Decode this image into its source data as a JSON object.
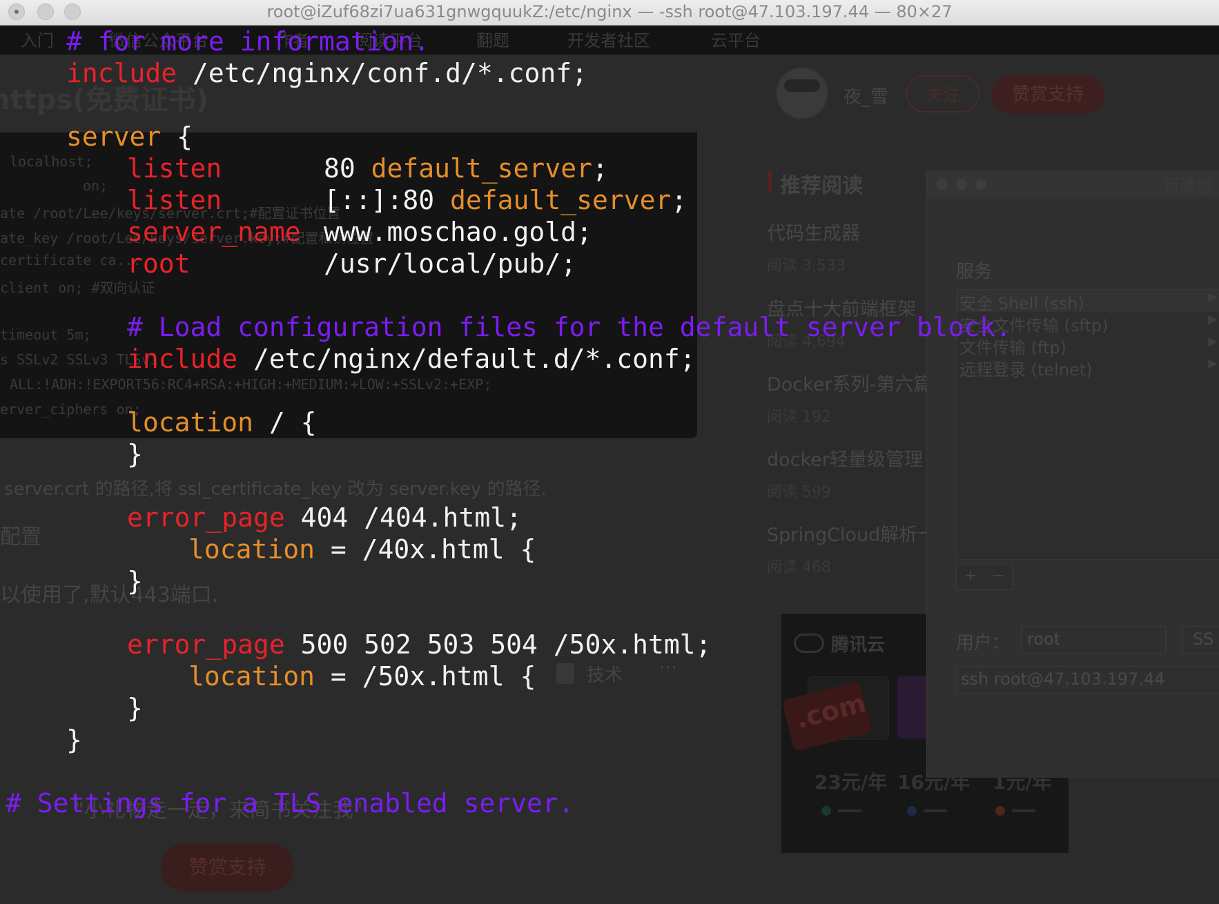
{
  "window": {
    "title": "root@iZuf68zi7ua631gnwgquukZ:/etc/nginx — -ssh root@47.103.197.44 — 80×27"
  },
  "colors": {
    "comment": "#7b1df0",
    "keyword": "#e8222a",
    "directive": "#e58e2a",
    "text": "#f2f2f2",
    "terminal_bg": "#2b2b2b"
  },
  "code": {
    "l1_comment": "# for more information.",
    "l2_kw": "include",
    "l2_val": " /etc/nginx/conf.d/*.conf;",
    "l3_kw": "server",
    "l3_val": " {",
    "l4_kw": "listen",
    "l4_num": "80",
    "l4_dir": "default_server",
    "l4_end": ";",
    "l5_kw": "listen",
    "l5_num": "[::]:80",
    "l5_dir": "default_server",
    "l5_end": ";",
    "l6_kw": "server_name",
    "l6_val": "www.moschao.gold;",
    "l7_kw": "root",
    "l7_val": "/usr/local/pub/;",
    "l8_comment": "# Load configuration files for the default server block.",
    "l9_kw": "include",
    "l9_val": " /etc/nginx/default.d/*.conf;",
    "l10_dir": "location",
    "l10_val": " / {",
    "l11_val": "}",
    "l12_kw": "error_page",
    "l12_val": " 404 /404.html;",
    "l13_dir": "location",
    "l13_val": " = /40x.html {",
    "l14_val": "}",
    "l15_kw": "error_page",
    "l15_val": " 500 502 503 504 /50x.html;",
    "l16_dir": "location",
    "l16_val": " = /50x.html {",
    "l17_val": "}",
    "l18_val": "}",
    "l19_comment": "# Settings for a TLS enabled server."
  },
  "background": {
    "heading": "https(免费证书)",
    "author": "夜_雪",
    "follow": "关注",
    "tip": "赞赏支持",
    "recommend_title": "推荐阅读",
    "articles": [
      {
        "title": "代码生成器",
        "reads": "阅读 3,533"
      },
      {
        "title": "盘点十大前端框架",
        "reads": "阅读 4,694"
      },
      {
        "title": "Docker系列-第六篇",
        "reads": "阅读 192"
      },
      {
        "title": "docker轻量级管理",
        "reads": "阅读 599"
      },
      {
        "title": "SpringCloud解析十",
        "reads": "阅读 468"
      }
    ],
    "left_snippets": {
      "s1": "localhost;",
      "s2": "on;",
      "s3": "ate     /root/Lee/keys/server.crt;#配置证书位置",
      "s4": "ate_key  /root/Lee/keys/server.key;#配置私钥位置",
      "s5": "certificate ca...",
      "s6": "client on; #双向认证",
      "s7": "timeout  5m;",
      "s8": "s  SSLv2 SSLv3 TLSv1;",
      "s9": "ALL:!ADH:!EXPORT56:RC4+RSA:+HIGH:+MEDIUM:+LOW:+SSLv2:+EXP;",
      "s10": "erver_ciphers  on;"
    },
    "para1": "server.crt 的路径,将 ssl_certificate_key 改为 server.key 的路径.",
    "para2": "配置",
    "para3": "以使用了,默认443端口.",
    "tech": "技术",
    "tagline": "\"小礼物走一走，来简书关注我\"",
    "tip2": "赞赏支持",
    "nav": {
      "n1": "入门",
      "n2": "微信公众平台",
      "n3": "作者",
      "n4": "阅读平台",
      "n5": "翻题",
      "n6": "开发者社区",
      "n7": "云平台"
    },
    "dialog": {
      "new_label": "新建远",
      "service_label": "服务",
      "services": [
        "安全 Shell (ssh)",
        "安全文件传输 (sftp)",
        "文件传输 (ftp)",
        "远程登录 (telnet)"
      ],
      "plus": "+",
      "minus": "−",
      "user_label": "用户：",
      "user_value": "root",
      "ssh_label": "SS",
      "command": "ssh root@47.103.197.44"
    },
    "ad": {
      "brand": "腾讯云",
      "domain": ".com",
      "prices": [
        "23元/年",
        "16元/年",
        "1元/年"
      ]
    }
  }
}
